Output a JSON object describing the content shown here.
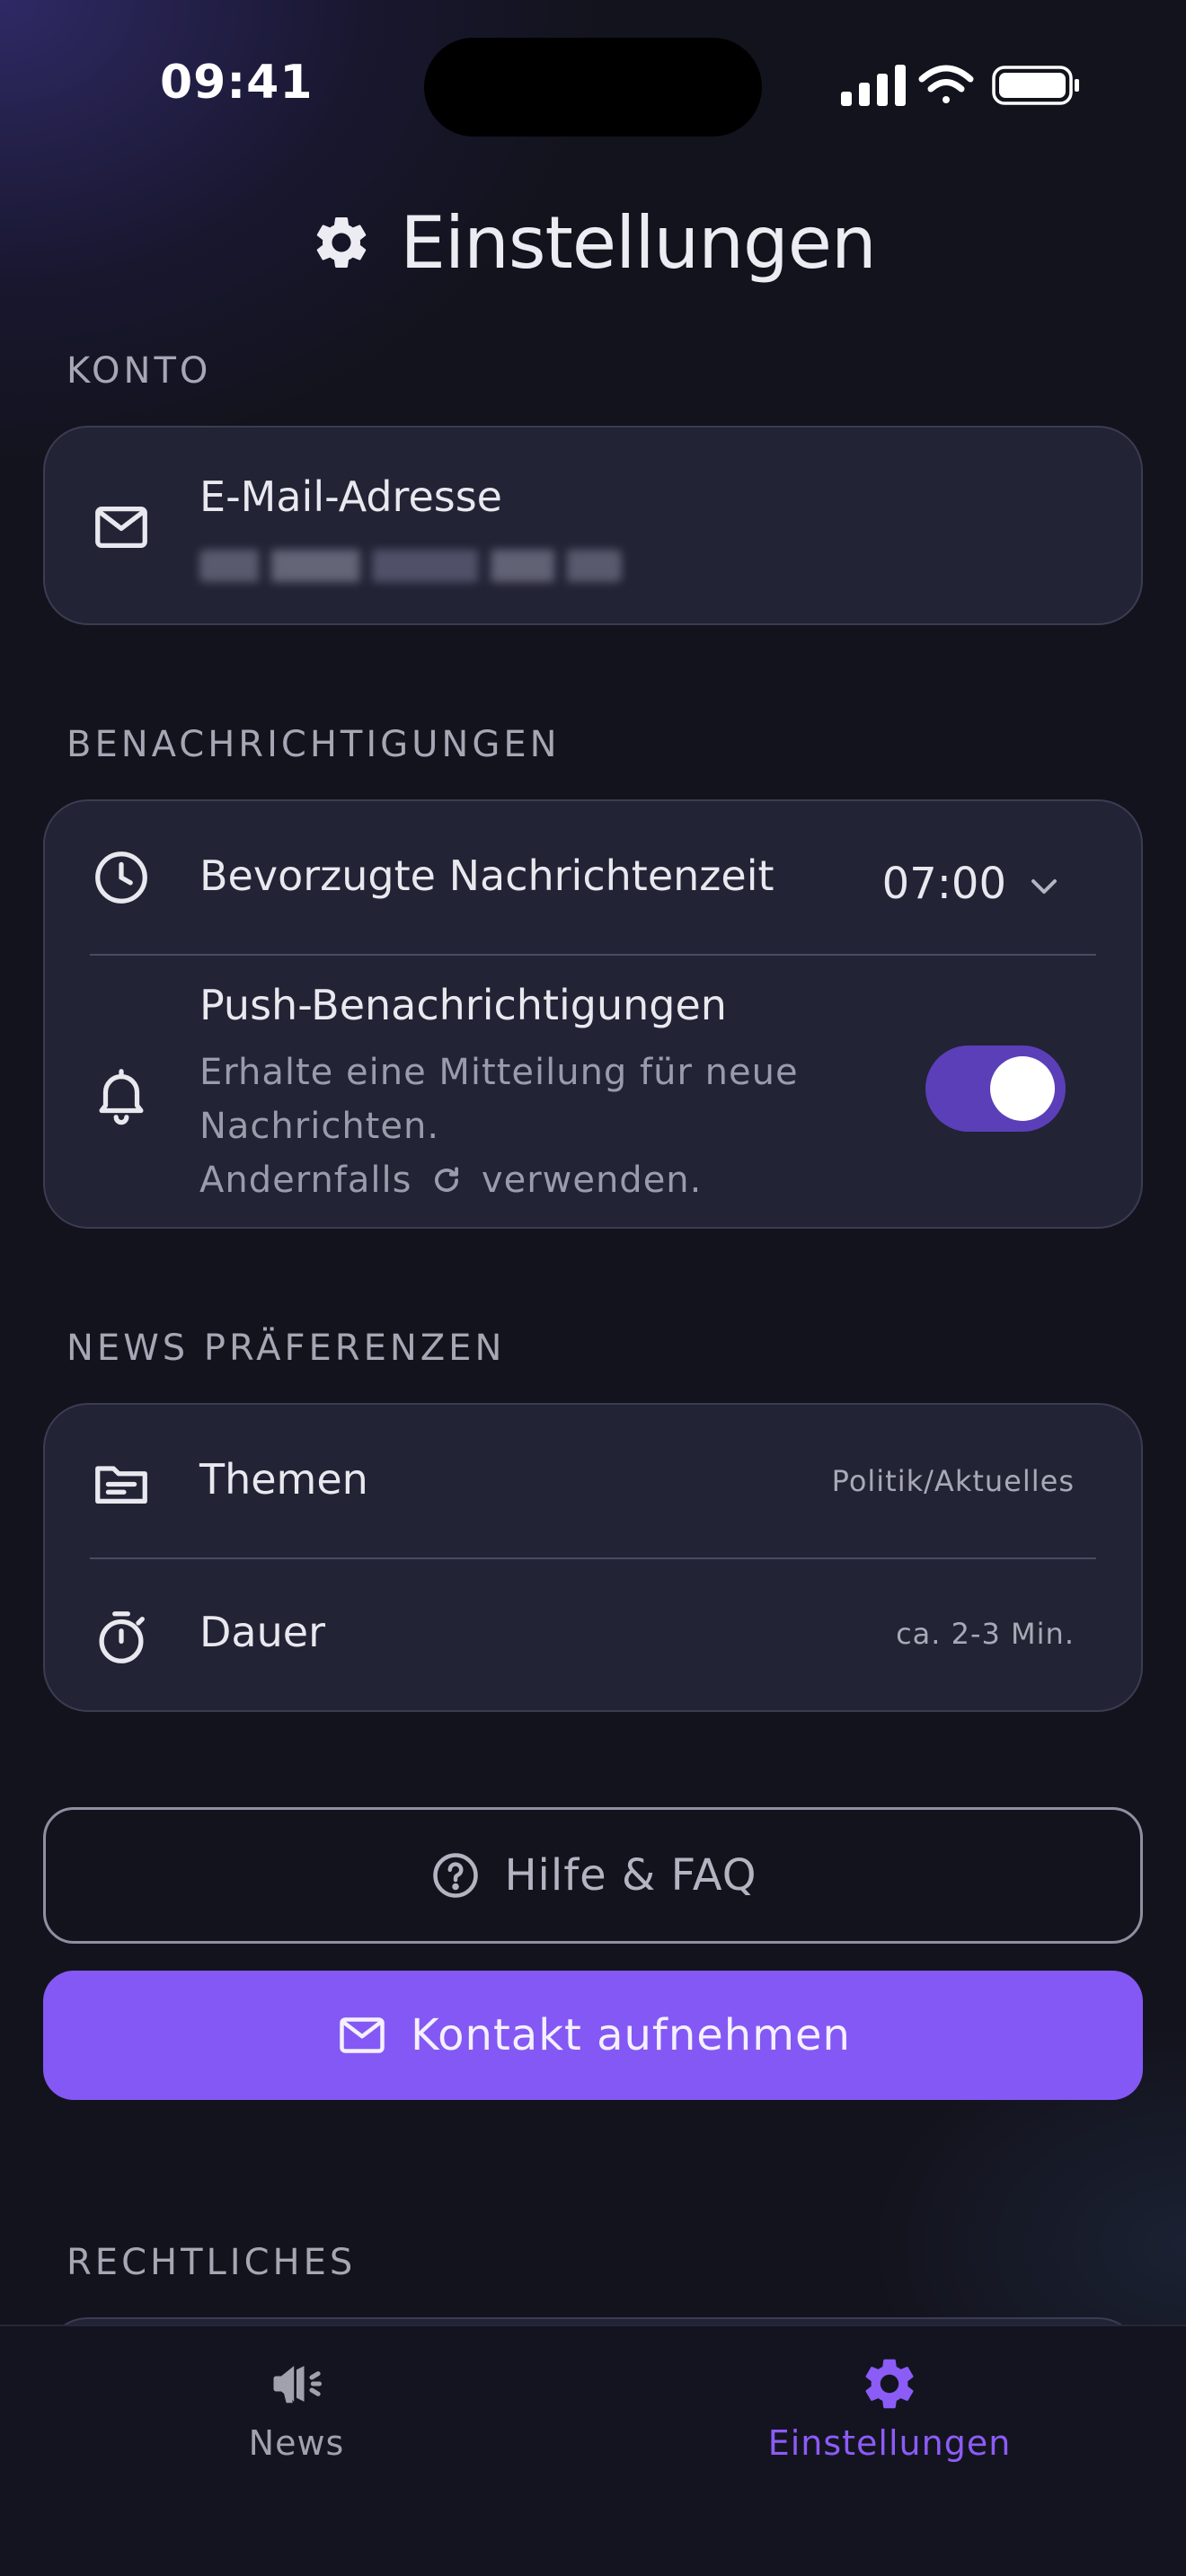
{
  "status_bar": {
    "time": "09:41"
  },
  "header": {
    "title": "Einstellungen",
    "icon": "gear-icon"
  },
  "account": {
    "section_label": "KONTO",
    "email_label": "E-Mail-Adresse",
    "email_icon": "mail-icon"
  },
  "notifications": {
    "section_label": "BENACHRICHTIGUNGEN",
    "time_label": "Bevorzugte Nachrichtenzeit",
    "time_value": "07:00",
    "push_label": "Push-Benachrichtigungen",
    "push_desc_line1": "Erhalte eine Mitteilung für neue",
    "push_desc_line2": "Nachrichten.",
    "push_desc_line3_before": "Andernfalls",
    "push_desc_line3_after": "verwenden.",
    "push_enabled": true
  },
  "preferences": {
    "section_label": "NEWS PRÄFERENZEN",
    "topics_label": "Themen",
    "topics_value": "Politik/Aktuelles",
    "duration_label": "Dauer",
    "duration_value": "ca. 2-3 Min."
  },
  "buttons": {
    "help_label": "Hilfe & FAQ",
    "contact_label": "Kontakt aufnehmen"
  },
  "legal": {
    "section_label": "RECHTLICHES"
  },
  "tabbar": {
    "news_label": "News",
    "settings_label": "Einstellungen",
    "active_tab": "settings"
  },
  "colors": {
    "accent": "#8458f4",
    "toggle_on": "#5b3fb8",
    "card_bg": "#222335",
    "background": "#13131d",
    "tab_active": "#8b5cf6",
    "tab_inactive": "#a0a1ad"
  }
}
